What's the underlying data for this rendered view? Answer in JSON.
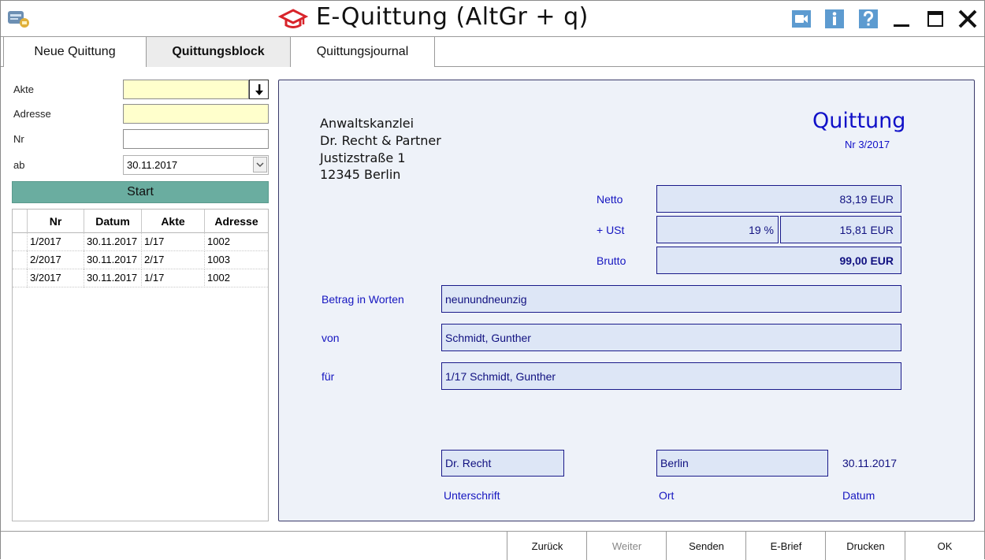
{
  "window": {
    "title": "E-Quittung (AltGr + q)",
    "icons": [
      "app-icon",
      "graduation-cap-icon",
      "video-icon",
      "info-icon",
      "help-icon"
    ],
    "controls": [
      "minimize-icon",
      "maximize-icon",
      "close-icon"
    ]
  },
  "tabs": [
    {
      "label": "Neue Quittung",
      "active": false
    },
    {
      "label": "Quittungsblock",
      "active": true
    },
    {
      "label": "Quittungsjournal",
      "active": false
    }
  ],
  "form": {
    "akte_label": "Akte",
    "akte_value": "",
    "adresse_label": "Adresse",
    "adresse_value": "",
    "nr_label": "Nr",
    "nr_value": "",
    "ab_label": "ab",
    "ab_value": "30.11.2017",
    "start_label": "Start"
  },
  "table": {
    "columns": [
      "Nr",
      "Datum",
      "Akte",
      "Adresse"
    ],
    "rows": [
      {
        "nr": "1/2017",
        "datum": "30.11.2017",
        "akte": "1/17",
        "adresse": "1002"
      },
      {
        "nr": "2/2017",
        "datum": "30.11.2017",
        "akte": "2/17",
        "adresse": "1003"
      },
      {
        "nr": "3/2017",
        "datum": "30.11.2017",
        "akte": "1/17",
        "adresse": "1002"
      }
    ]
  },
  "receipt": {
    "sender": [
      "Anwaltskanzlei",
      "Dr. Recht & Partner",
      "Justizstraße 1",
      "12345 Berlin"
    ],
    "title": "Quittung",
    "nr": "Nr   3/2017",
    "netto_label": "Netto",
    "netto_value": "83,19 EUR",
    "ust_label": "+ USt",
    "ust_rate": "19 %",
    "ust_value": "15,81 EUR",
    "brutto_label": "Brutto",
    "brutto_value": "99,00 EUR",
    "worte_label": "Betrag in Worten",
    "worte_value": "neunundneunzig",
    "von_label": "von",
    "von_value": "Schmidt, Gunther",
    "fuer_label": "für",
    "fuer_value": "1/17 Schmidt, Gunther",
    "unterschrift_value": "Dr. Recht",
    "unterschrift_label": "Unterschrift",
    "ort_value": "Berlin",
    "ort_label": "Ort",
    "datum_value": "30.11.2017",
    "datum_label": "Datum",
    "colors": {
      "label": "#1515c0",
      "box_bg": "#dde6f6",
      "box_border": "#1a1a8a",
      "panel_bg": "#eef2f9"
    }
  },
  "buttons": {
    "zurueck": "Zurück",
    "weiter": "Weiter",
    "senden": "Senden",
    "ebrief": "E-Brief",
    "drucken": "Drucken",
    "ok": "OK"
  },
  "accent": {
    "start_button": "#6aada0",
    "input_highlight": "#ffffcc"
  }
}
